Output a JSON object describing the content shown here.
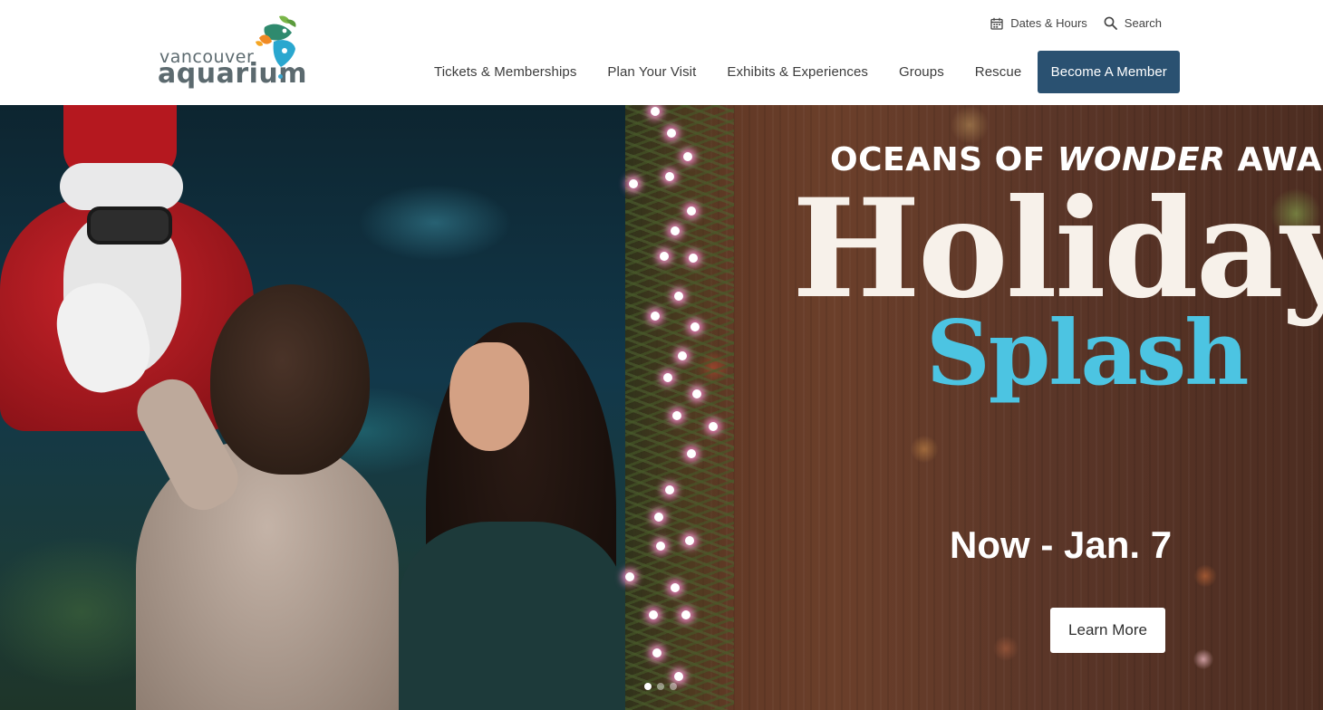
{
  "logo": {
    "word_small": "vancouver",
    "word_big": "aquarium"
  },
  "utility": {
    "dates_label": "Dates & Hours",
    "search_label": "Search"
  },
  "nav": {
    "items": [
      {
        "label": "Tickets & Memberships"
      },
      {
        "label": "Plan Your Visit"
      },
      {
        "label": "Exhibits & Experiences"
      },
      {
        "label": "Groups"
      },
      {
        "label": "Rescue"
      }
    ],
    "cta_label": "Become A Member"
  },
  "hero": {
    "eyebrow_a": "OCEANS OF ",
    "eyebrow_b": "WONDER",
    "eyebrow_c": " AWAIT",
    "title_line1": "Holiday",
    "title_line2": "Splash",
    "dates": "Now - Jan. 7",
    "cta_label": "Learn More",
    "carousel": {
      "count": 3,
      "active": 1
    }
  },
  "colors": {
    "primary": "#2a5171",
    "accent_blue": "#4cc4e2",
    "title_cream": "#f7f1ea"
  },
  "icons": [
    "calendar-icon",
    "search-icon",
    "logo-fish-icon"
  ]
}
